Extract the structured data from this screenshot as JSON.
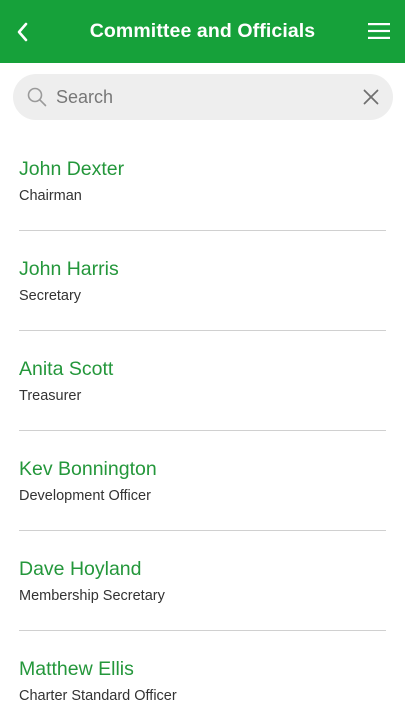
{
  "header": {
    "title": "Committee and Officials",
    "background_color": "#16a13a",
    "back_icon": "chevron-left-icon",
    "menu_icon": "hamburger-menu-icon"
  },
  "search": {
    "placeholder": "Search",
    "value": "",
    "search_icon": "search-icon",
    "clear_icon": "close-icon"
  },
  "officials": [
    {
      "name": "John Dexter",
      "role": "Chairman"
    },
    {
      "name": "John Harris",
      "role": "Secretary"
    },
    {
      "name": "Anita Scott",
      "role": "Treasurer"
    },
    {
      "name": "Kev Bonnington",
      "role": "Development Officer"
    },
    {
      "name": "Dave Hoyland",
      "role": "Membership Secretary"
    },
    {
      "name": "Matthew Ellis",
      "role": "Charter Standard Officer"
    }
  ],
  "colors": {
    "accent": "#16a13a",
    "name_text": "#24973b",
    "role_text": "#333333",
    "divider": "#d0d0d0",
    "search_bg": "#eeeeee"
  }
}
